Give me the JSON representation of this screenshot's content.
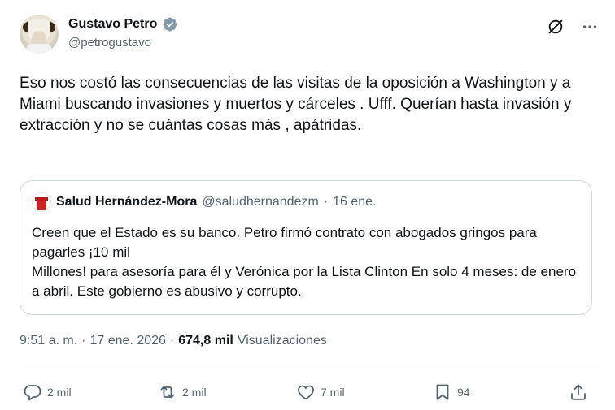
{
  "author": {
    "name": "Gustavo Petro",
    "handle": "@petrogustavo",
    "verified_color": "#829aab"
  },
  "tweet": {
    "text": "Eso nos costó las consecuencias de las visitas de la oposición a Washington y a Miami buscando invasiones y muertos y cárceles . Ufff. Querían hasta invasión y extracción y no se cuántas cosas más , apátridas."
  },
  "quote": {
    "name": "Salud Hernández-Mora",
    "handle": "@saludhernandezm",
    "separator": "·",
    "date": "16 ene.",
    "text_line1": "Creen que el Estado es su banco. Petro firmó contrato con abogados gringos para pagarles ¡10 mil",
    "text_line2": "Millones! para asesoría para él y Verónica por la Lista Clinton En solo 4 meses: de enero a abril. Este gobierno es abusivo y corrupto."
  },
  "meta": {
    "time": "9:51 a. m.",
    "sep1": "·",
    "date": "17 ene. 2026",
    "sep2": "·",
    "views_count": "674,8 mil",
    "views_label": "Visualizaciones"
  },
  "actions": {
    "replies": "2 mil",
    "reposts": "2 mil",
    "likes": "7 mil",
    "bookmarks": "94"
  },
  "icons": {
    "grok": "grok-icon",
    "more": "more-icon",
    "reply": "reply-icon",
    "repost": "repost-icon",
    "like": "heart-icon",
    "bookmark": "bookmark-icon",
    "share": "share-icon"
  },
  "colors": {
    "text": "#0f1419",
    "secondary": "#536471",
    "border": "#cfd9de"
  }
}
